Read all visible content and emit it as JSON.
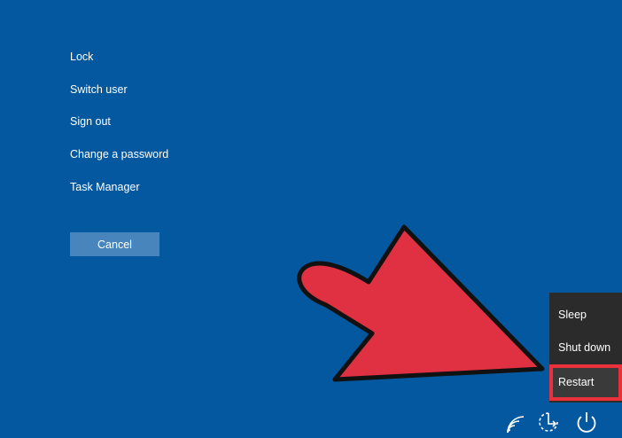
{
  "menu": {
    "items": [
      {
        "label": "Lock"
      },
      {
        "label": "Switch user"
      },
      {
        "label": "Sign out"
      },
      {
        "label": "Change a password"
      },
      {
        "label": "Task Manager"
      }
    ]
  },
  "cancel_label": "Cancel",
  "power_menu": {
    "items": [
      {
        "label": "Sleep"
      },
      {
        "label": "Shut down"
      },
      {
        "label": "Restart",
        "highlighted": true
      }
    ]
  },
  "tray": {
    "icons": [
      "network-icon",
      "ease-of-access-icon",
      "power-icon"
    ]
  },
  "colors": {
    "background": "#0358a0",
    "cancel_button": "#4785bc",
    "power_menu_bg": "#2b2b2b",
    "highlight": "#e8313b",
    "arrow_fill": "#e03143"
  }
}
